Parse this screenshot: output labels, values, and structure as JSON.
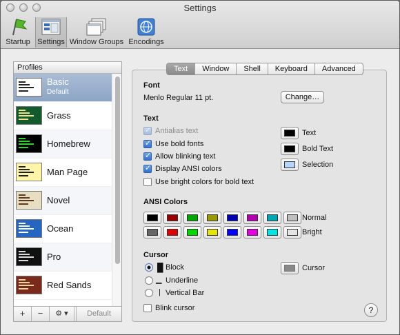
{
  "window": {
    "title": "Settings"
  },
  "toolbar": [
    {
      "label": "Startup",
      "icon": "startup-flag-icon"
    },
    {
      "label": "Settings",
      "icon": "settings-window-icon",
      "active": true
    },
    {
      "label": "Window Groups",
      "icon": "window-groups-icon"
    },
    {
      "label": "Encodings",
      "icon": "encodings-globe-icon"
    }
  ],
  "profiles": {
    "header": "Profiles",
    "items": [
      {
        "name": "Basic",
        "sub": "Default",
        "selected": true,
        "bg": "#ffffff",
        "fg": "#222222"
      },
      {
        "name": "Grass",
        "bg": "#135b2c",
        "fg": "#f5e08a"
      },
      {
        "name": "Homebrew",
        "bg": "#000000",
        "fg": "#29d629"
      },
      {
        "name": "Man Page",
        "bg": "#fff5a8",
        "fg": "#222222"
      },
      {
        "name": "Novel",
        "bg": "#e8dfc2",
        "fg": "#5a3b1d"
      },
      {
        "name": "Ocean",
        "bg": "#2466c2",
        "fg": "#ffffff"
      },
      {
        "name": "Pro",
        "bg": "#111111",
        "fg": "#dddddd"
      },
      {
        "name": "Red Sands",
        "bg": "#7a2a1a",
        "fg": "#e8d4a0"
      }
    ],
    "footer": {
      "add": "+",
      "remove": "−",
      "gear": "⚙ ▾",
      "default_label": "Default"
    }
  },
  "tabs": [
    "Text",
    "Window",
    "Shell",
    "Keyboard",
    "Advanced"
  ],
  "active_tab": "Text",
  "font": {
    "heading": "Font",
    "value": "Menlo Regular 11 pt.",
    "change_button": "Change…"
  },
  "text": {
    "heading": "Text",
    "options": [
      {
        "label": "Antialias text",
        "checked": true,
        "disabled": true
      },
      {
        "label": "Use bold fonts",
        "checked": true
      },
      {
        "label": "Allow blinking text",
        "checked": true
      },
      {
        "label": "Display ANSI colors",
        "checked": true
      },
      {
        "label": "Use bright colors for bold text",
        "checked": false
      }
    ],
    "colors": [
      {
        "label": "Text",
        "color": "#000000"
      },
      {
        "label": "Bold Text",
        "color": "#000000"
      },
      {
        "label": "Selection",
        "color": "#b5d5ff"
      }
    ]
  },
  "ansi": {
    "heading": "ANSI Colors",
    "normal_label": "Normal",
    "bright_label": "Bright",
    "normal": [
      "#000000",
      "#990000",
      "#00a600",
      "#999900",
      "#0000b2",
      "#b200b2",
      "#00a6b2",
      "#bfbfbf"
    ],
    "bright": [
      "#666666",
      "#e50000",
      "#00d900",
      "#e5e500",
      "#0000ff",
      "#e500e5",
      "#00e5e5",
      "#e5e5e5"
    ]
  },
  "cursor": {
    "heading": "Cursor",
    "options": [
      {
        "label": "Block",
        "glyph": "█",
        "selected": true
      },
      {
        "label": "Underline",
        "glyph": "▁",
        "selected": false
      },
      {
        "label": "Vertical Bar",
        "glyph": "|",
        "selected": false
      }
    ],
    "color_label": "Cursor",
    "color": "#888888",
    "blink_label": "Blink cursor",
    "blink": false
  },
  "help": "?"
}
